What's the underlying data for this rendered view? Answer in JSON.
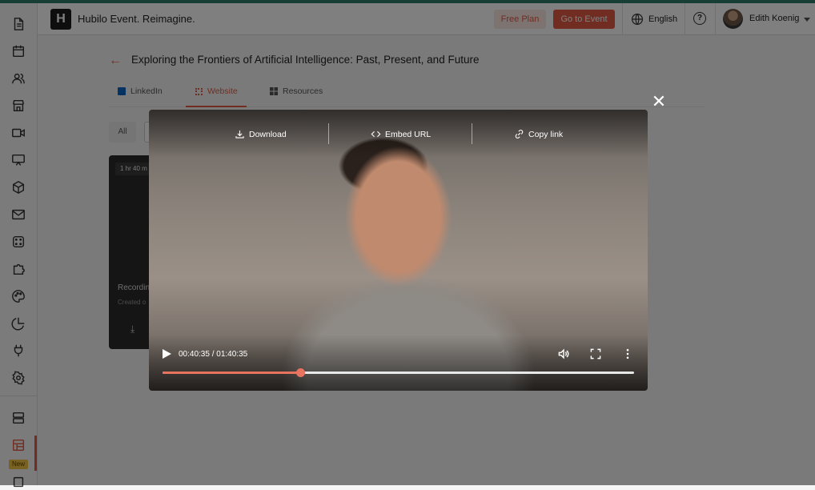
{
  "header": {
    "logo_letter": "H",
    "app_title": "Hubilo Event. Reimagine.",
    "free_plan_label": "Free Plan",
    "go_to_event_label": "Go to Event",
    "language": "English",
    "help_glyph": "?",
    "user_name": "Edith Koenig"
  },
  "sidebar": {
    "items": [
      "file-icon",
      "calendar-icon",
      "people-icon",
      "store-icon",
      "video-icon",
      "presentation-icon",
      "box-icon",
      "mail-icon",
      "dice-icon",
      "puzzle-icon",
      "palette-icon",
      "pie-chart-icon",
      "plug-icon",
      "settings-icon",
      "server-icon",
      "layout-icon",
      "square-icon"
    ],
    "new_badge": "New"
  },
  "page": {
    "back_glyph": "←",
    "title": "Exploring the Frontiers of Artificial Intelligence: Past, Present, and Future",
    "tabs": [
      {
        "label": "LinkedIn",
        "icon": "linkedin-icon"
      },
      {
        "label": "Website",
        "icon": "website-icon"
      },
      {
        "label": "Resources",
        "icon": "grid-icon"
      }
    ],
    "active_tab": "Website",
    "filter_all": "All",
    "card": {
      "duration": "1 hr 40 m",
      "label": "Recordin",
      "sub": "Created o"
    }
  },
  "modal": {
    "close_glyph": "✕",
    "actions": [
      {
        "label": "Download",
        "icon": "download-icon"
      },
      {
        "label": "Embed URL",
        "icon": "code-icon"
      },
      {
        "label": "Copy link",
        "icon": "link-icon"
      }
    ],
    "time_display": "00:40:35 / 01:40:35",
    "progress_fraction": 0.292
  },
  "colors": {
    "accent": "#e45a44",
    "progress": "#e8735f"
  }
}
